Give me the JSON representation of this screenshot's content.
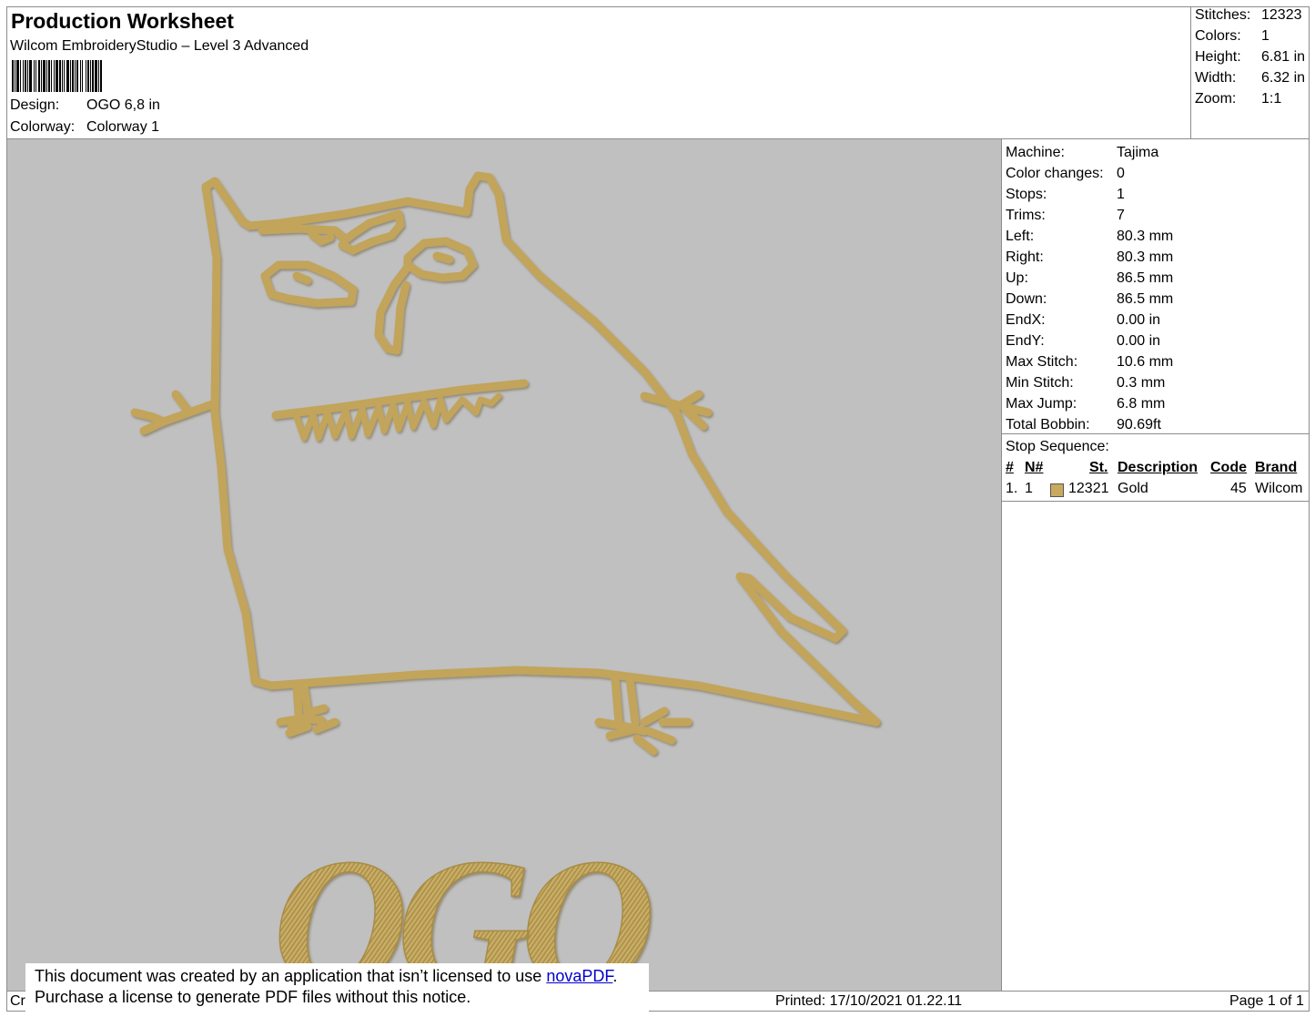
{
  "header": {
    "title": "Production Worksheet",
    "subtitle": "Wilcom EmbroideryStudio – Level 3 Advanced",
    "barcode_icon": "barcode-icon",
    "design_label": "Design:",
    "design_value": "OGO 6,8 in",
    "colorway_label": "Colorway:",
    "colorway_value": "Colorway 1"
  },
  "stats": [
    {
      "label": "Stitches:",
      "value": "12323"
    },
    {
      "label": "Colors:",
      "value": "1"
    },
    {
      "label": "Height:",
      "value": "6.81 in"
    },
    {
      "label": "Width:",
      "value": "6.32 in"
    },
    {
      "label": "Zoom:",
      "value": "1:1"
    }
  ],
  "design": {
    "text": "OGO",
    "thread_color": "#c8a95f",
    "background_color": "#c0c0c0"
  },
  "machine_info": [
    {
      "label": "Machine:",
      "value": "Tajima"
    },
    {
      "label": "Color changes:",
      "value": "0"
    },
    {
      "label": "Stops:",
      "value": "1"
    },
    {
      "label": "Trims:",
      "value": "7"
    },
    {
      "label": "Left:",
      "value": "80.3 mm"
    },
    {
      "label": "Right:",
      "value": "80.3 mm"
    },
    {
      "label": "Up:",
      "value": "86.5 mm"
    },
    {
      "label": "Down:",
      "value": "86.5 mm"
    },
    {
      "label": "EndX:",
      "value": "0.00 in"
    },
    {
      "label": "EndY:",
      "value": "0.00 in"
    },
    {
      "label": "Max Stitch:",
      "value": "10.6 mm"
    },
    {
      "label": "Min Stitch:",
      "value": "0.3 mm"
    },
    {
      "label": "Max Jump:",
      "value": "6.8 mm"
    },
    {
      "label": "Total Bobbin:",
      "value": "90.69ft"
    }
  ],
  "stop_sequence": {
    "title": "Stop Sequence:",
    "columns": {
      "num": "#",
      "needle": "N#",
      "st": "St.",
      "description": "Description",
      "code": "Code",
      "brand": "Brand"
    },
    "rows": [
      {
        "num": "1.",
        "needle": "1",
        "st": "12321",
        "description": "Gold",
        "code": "45",
        "brand": "Wilcom",
        "color": "#c8a95f"
      }
    ]
  },
  "footer": {
    "left_fragment": "Cr",
    "printed": "Printed: 17/10/2021 01.22.11",
    "page": "Page 1 of 1"
  },
  "notice": {
    "line1_prefix": "This document was created by an application that isn’t licensed to use ",
    "link": "novaPDF",
    "line1_suffix": ".",
    "line2": "Purchase a license to generate PDF files without this notice."
  }
}
